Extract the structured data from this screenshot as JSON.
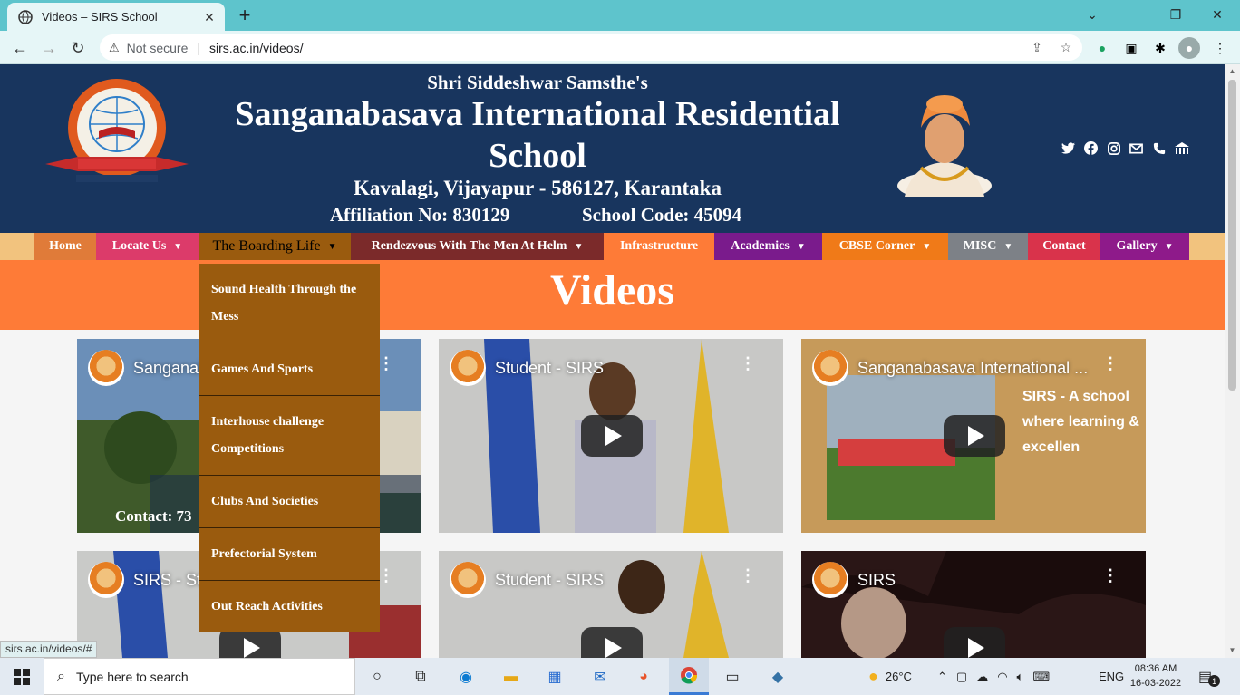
{
  "browser": {
    "tab_title": "Videos – SIRS School",
    "url": "sirs.ac.in/videos/",
    "security_label": "Not secure"
  },
  "header": {
    "subtitle": "Shri Siddeshwar Samsthe's",
    "title": "Sanganabasava International Residential School",
    "address": "Kavalagi, Vijayapur - 586127, Karantaka",
    "affiliation": "Affiliation No: 830129",
    "school_code": "School Code: 45094"
  },
  "nav": [
    {
      "label": "Home",
      "color": "#e07b39"
    },
    {
      "label": "Locate Us",
      "color": "#dc3b6a"
    },
    {
      "label": "The Boarding Life",
      "color": "#9a5b0e"
    },
    {
      "label": "Rendezvous With The Men At Helm",
      "color": "#7b2a2a"
    },
    {
      "label": "Infrastructure",
      "color": "#fe7b37"
    },
    {
      "label": "Academics",
      "color": "#7a1b8c"
    },
    {
      "label": "CBSE Corner",
      "color": "#f07a18"
    },
    {
      "label": "MISC",
      "color": "#7d8187"
    },
    {
      "label": "Contact",
      "color": "#d9334b"
    },
    {
      "label": "Gallery",
      "color": "#8e1a8a"
    }
  ],
  "dropdown": [
    "Sound Health Through the Mess",
    "Games And Sports",
    "Interhouse challenge Competitions",
    "Clubs And Societies",
    "Prefectorial System",
    "Out Reach Activities"
  ],
  "page_title": "Videos",
  "videos": [
    {
      "title": "Sanganab..."
    },
    {
      "title": "Student - SIRS"
    },
    {
      "title": "Sanganabasava International ..."
    },
    {
      "title": "SIRS - St..."
    },
    {
      "title": "Student - SIRS"
    },
    {
      "title": "SIRS"
    }
  ],
  "video_overlay": {
    "tagline": "SIRS - A school where learning & excellen",
    "contact": "Contact: 73"
  },
  "status_url": "sirs.ac.in/videos/#",
  "taskbar": {
    "search_placeholder": "Type here to search",
    "temperature": "26°C",
    "language": "ENG",
    "time": "08:36 AM",
    "date": "16-03-2022",
    "notification_count": "1"
  }
}
